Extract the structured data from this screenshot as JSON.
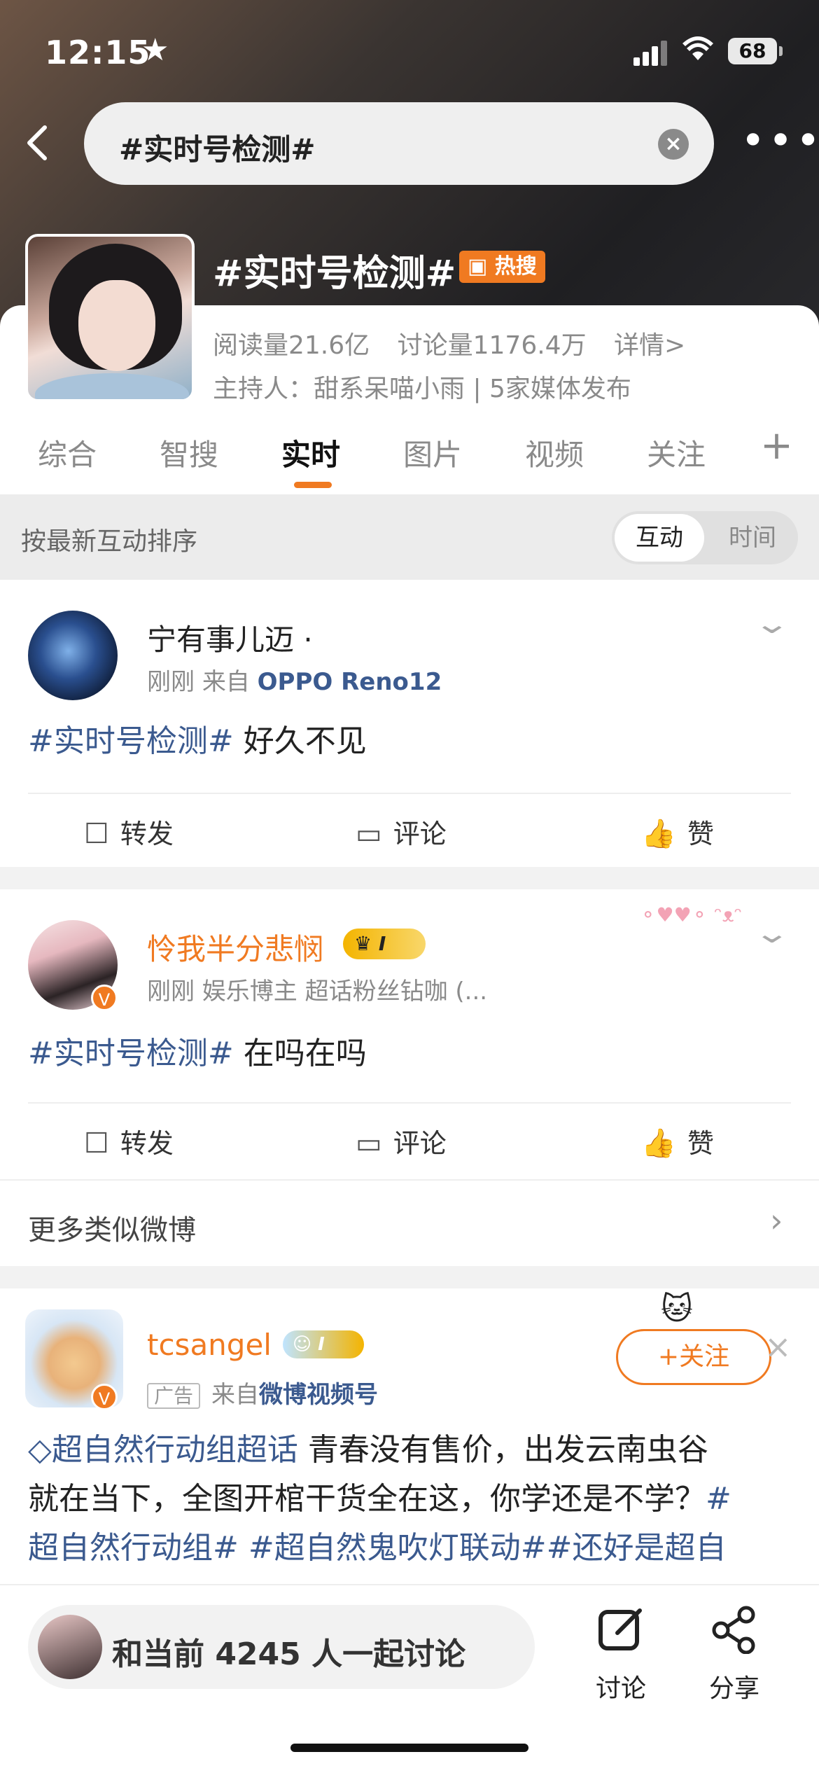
{
  "status": {
    "time": "12:15",
    "battery": "68"
  },
  "search": {
    "query": "#实时号检测#"
  },
  "topic": {
    "title": "#实时号检测#",
    "badge": "热搜",
    "reads": "阅读量21.6亿",
    "discussions": "讨论量1176.4万",
    "details": "详情>",
    "host": "主持人：甜系呆喵小雨 | 5家媒体发布"
  },
  "tabs": [
    "综合",
    "智搜",
    "实时",
    "图片",
    "视频",
    "关注"
  ],
  "sort": {
    "label": "按最新互动排序",
    "option_active": "互动",
    "option_inactive": "时间"
  },
  "posts": [
    {
      "username": "宁有事儿迈 ·",
      "time": "刚刚",
      "source_prefix": "来自",
      "source": "OPPO Reno12",
      "hashtag": "#实时号检测#",
      "text": " 好久不见",
      "repost": "转发",
      "comment": "评论",
      "like": "赞"
    },
    {
      "username": "怜我半分悲悯",
      "meta": "刚刚  娱乐博主 超话粉丝钻咖 (...",
      "hashtag": "#实时号检测#",
      "text": " 在吗在吗",
      "repost": "转发",
      "comment": "评论",
      "like": "赞"
    }
  ],
  "more_similar": "更多类似微博",
  "ad": {
    "username": "tcsangel",
    "tag": "广告",
    "source_prefix": "来自",
    "source": "微博视频号",
    "follow": "+关注",
    "topic": "超自然行动组超话",
    "line1": " 青春没有售价，出发云南虫谷",
    "line2": "就在当下，全图开棺干货全在这，你学还是不学？",
    "line2_tag": "#",
    "line3_tag1": "超自然行动组#",
    "line3_tag2": " #超自然鬼吹灯联动##还好是超自"
  },
  "bottom": {
    "discuss": "和当前 4245 人一起讨论",
    "comment": "讨论",
    "share": "分享"
  },
  "colors": {
    "accent": "#f07a21",
    "link": "#3b5a8f"
  }
}
